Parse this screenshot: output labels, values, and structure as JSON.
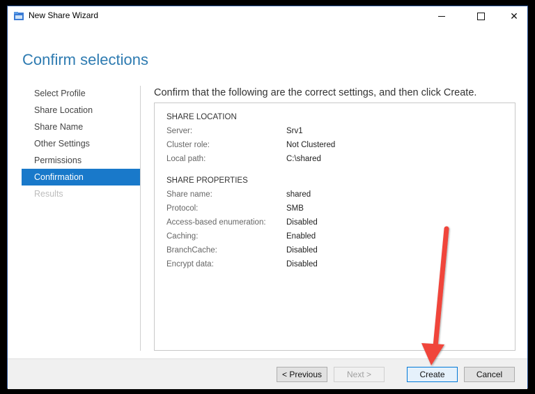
{
  "window": {
    "title": "New Share Wizard",
    "controls": {
      "minimize": "minimize",
      "maximize": "maximize",
      "close": "✕"
    }
  },
  "page": {
    "title": "Confirm selections",
    "instruction": "Confirm that the following are the correct settings, and then click Create."
  },
  "nav": {
    "items": [
      {
        "label": "Select Profile",
        "state": "normal"
      },
      {
        "label": "Share Location",
        "state": "normal"
      },
      {
        "label": "Share Name",
        "state": "normal"
      },
      {
        "label": "Other Settings",
        "state": "normal"
      },
      {
        "label": "Permissions",
        "state": "normal"
      },
      {
        "label": "Confirmation",
        "state": "active"
      },
      {
        "label": "Results",
        "state": "disabled"
      }
    ]
  },
  "summary": {
    "share_location": {
      "heading": "SHARE LOCATION",
      "rows": [
        {
          "label": "Server:",
          "value": "Srv1"
        },
        {
          "label": "Cluster role:",
          "value": "Not Clustered"
        },
        {
          "label": "Local path:",
          "value": "C:\\shared"
        }
      ]
    },
    "share_properties": {
      "heading": "SHARE PROPERTIES",
      "rows": [
        {
          "label": "Share name:",
          "value": "shared"
        },
        {
          "label": "Protocol:",
          "value": "SMB"
        },
        {
          "label": "Access-based enumeration:",
          "value": "Disabled"
        },
        {
          "label": "Caching:",
          "value": "Enabled"
        },
        {
          "label": "BranchCache:",
          "value": "Disabled"
        },
        {
          "label": "Encrypt data:",
          "value": "Disabled"
        }
      ]
    }
  },
  "footer": {
    "previous_label": "< Previous",
    "next_label": "Next >",
    "create_label": "Create",
    "cancel_label": "Cancel"
  },
  "colors": {
    "accent": "#1979ca",
    "title": "#2e7bb1",
    "annotation_arrow": "#f0443a"
  }
}
